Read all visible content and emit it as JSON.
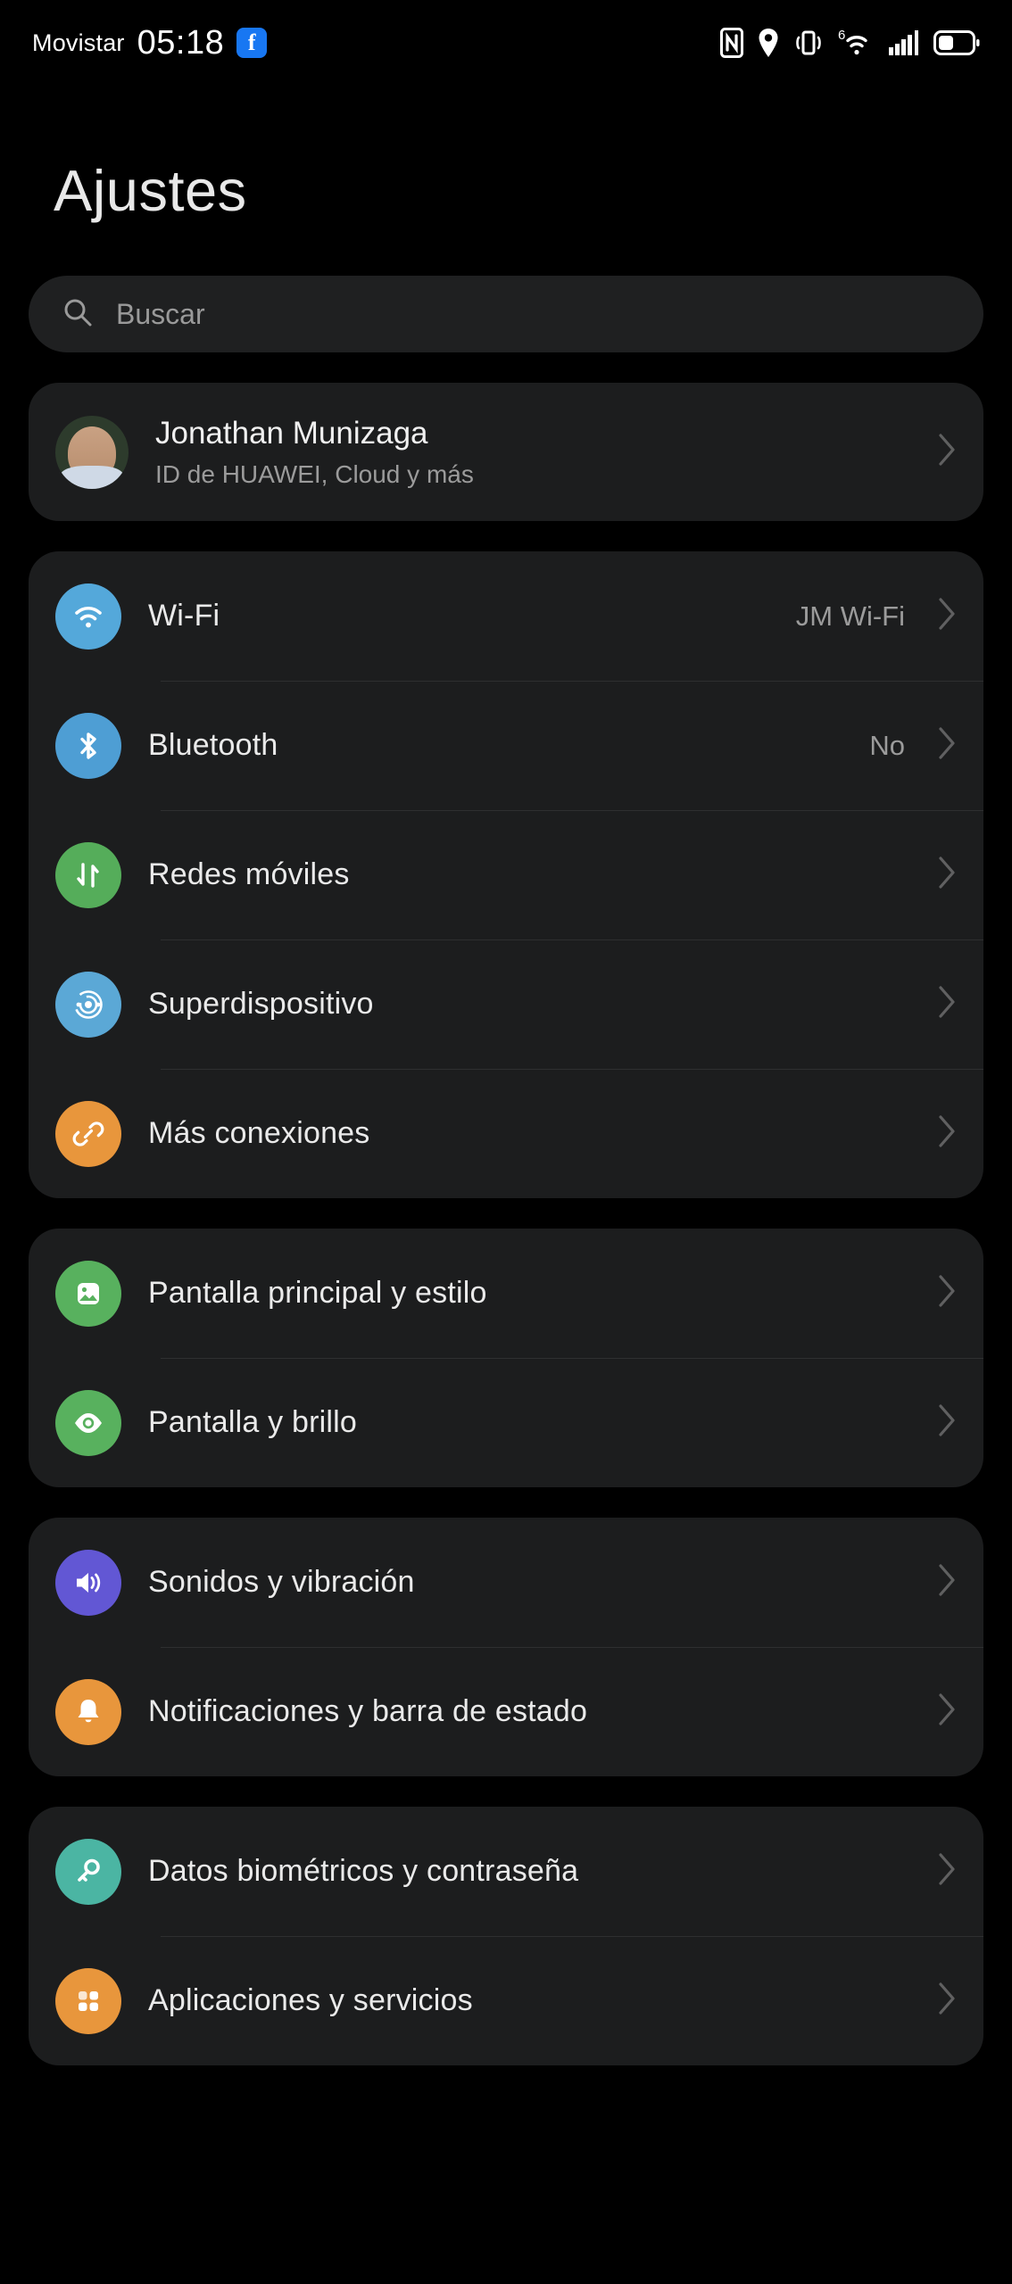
{
  "statusbar": {
    "carrier": "Movistar",
    "time": "05:18",
    "facebook_badge": "f",
    "icons": [
      "nfc-icon",
      "location-icon",
      "vibrate-icon",
      "wifi6-icon",
      "cellular-signal-icon",
      "battery-icon"
    ],
    "wifi_generation": "6"
  },
  "header": {
    "title": "Ajustes"
  },
  "search": {
    "placeholder": "Buscar",
    "value": ""
  },
  "profile": {
    "name": "Jonathan Munizaga",
    "subtitle": "ID de HUAWEI, Cloud y más"
  },
  "sections": [
    {
      "name": "connectivity",
      "rows": [
        {
          "label": "Wi-Fi",
          "value": "JM Wi-Fi",
          "icon": "wifi-icon",
          "color": "#54a8da"
        },
        {
          "label": "Bluetooth",
          "value": "No",
          "icon": "bluetooth-icon",
          "color": "#4e9ed4"
        },
        {
          "label": "Redes móviles",
          "value": "",
          "icon": "mobile-data-icon",
          "color": "#55ad5a"
        },
        {
          "label": "Superdispositivo",
          "value": "",
          "icon": "superdevice-icon",
          "color": "#5ba8d6"
        },
        {
          "label": "Más conexiones",
          "value": "",
          "icon": "link-icon",
          "color": "#e8963c"
        }
      ]
    },
    {
      "name": "display",
      "rows": [
        {
          "label": "Pantalla principal y estilo",
          "value": "",
          "icon": "wallpaper-icon",
          "color": "#58b15e"
        },
        {
          "label": "Pantalla y brillo",
          "value": "",
          "icon": "eye-icon",
          "color": "#58b15e"
        }
      ]
    },
    {
      "name": "sound",
      "rows": [
        {
          "label": "Sonidos y vibración",
          "value": "",
          "icon": "volume-icon",
          "color": "#6257d4"
        },
        {
          "label": "Notificaciones y barra de estado",
          "value": "",
          "icon": "bell-icon",
          "color": "#e8963c"
        }
      ]
    },
    {
      "name": "security",
      "rows": [
        {
          "label": "Datos biométricos y contraseña",
          "value": "",
          "icon": "key-icon",
          "color": "#4bb5a3"
        },
        {
          "label": "Aplicaciones y servicios",
          "value": "",
          "icon": "apps-grid-icon",
          "color": "#e8963c"
        }
      ]
    }
  ]
}
